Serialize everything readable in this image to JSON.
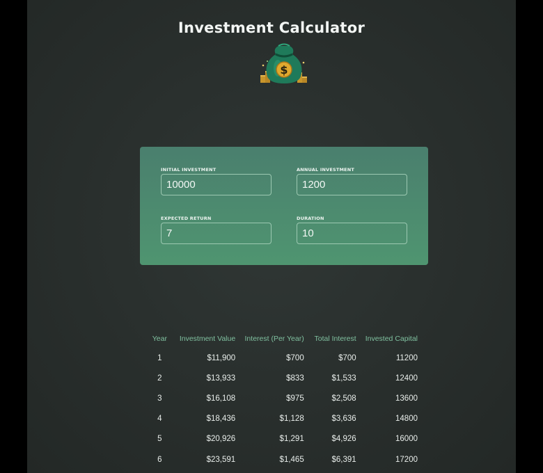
{
  "header": {
    "title": "Investment Calculator",
    "logo_icon": "money-bag-icon"
  },
  "colors": {
    "background": "#2a302e",
    "panel_top": "#4a7f6e",
    "panel_bottom": "#4f9570",
    "table_header": "#80c1a0",
    "text": "#e9eeeb"
  },
  "inputs": {
    "initial_investment": {
      "label": "INITIAL INVESTMENT",
      "value": "10000"
    },
    "annual_investment": {
      "label": "ANNUAL INVESTMENT",
      "value": "1200"
    },
    "expected_return": {
      "label": "EXPECTED RETURN",
      "value": "7"
    },
    "duration": {
      "label": "DURATION",
      "value": "10"
    }
  },
  "results": {
    "headers": [
      "Year",
      "Investment Value",
      "Interest (Per Year)",
      "Total Interest",
      "Invested Capital"
    ],
    "rows": [
      [
        "1",
        "$11,900",
        "$700",
        "$700",
        "11200"
      ],
      [
        "2",
        "$13,933",
        "$833",
        "$1,533",
        "12400"
      ],
      [
        "3",
        "$16,108",
        "$975",
        "$2,508",
        "13600"
      ],
      [
        "4",
        "$18,436",
        "$1,128",
        "$3,636",
        "14800"
      ],
      [
        "5",
        "$20,926",
        "$1,291",
        "$4,926",
        "16000"
      ],
      [
        "6",
        "$23,591",
        "$1,465",
        "$6,391",
        "17200"
      ]
    ]
  }
}
